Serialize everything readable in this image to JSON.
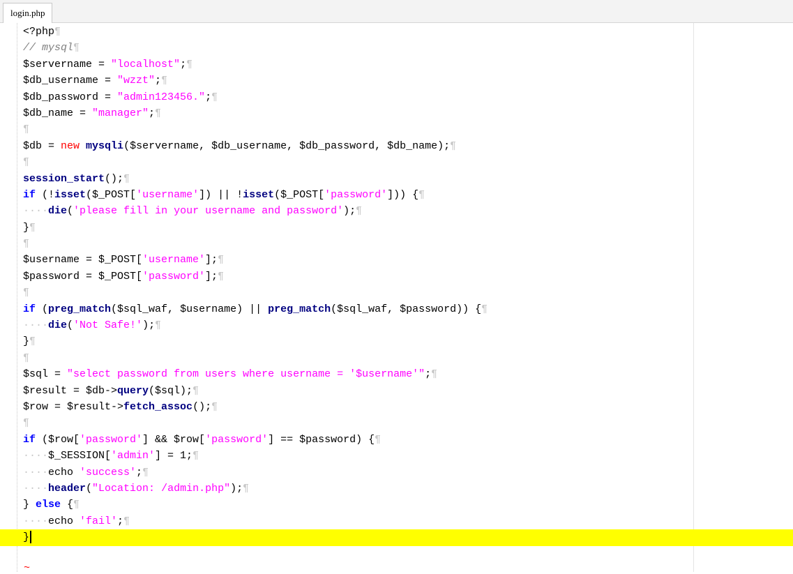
{
  "tab": {
    "label": "login.php"
  },
  "end_marker": "~",
  "lines": [
    [
      {
        "t": "<?php",
        "c": "t"
      }
    ],
    [
      {
        "t": "// mysql",
        "c": "cm"
      }
    ],
    [
      {
        "t": "$servername = ",
        "c": "t"
      },
      {
        "t": "\"localhost\"",
        "c": "str"
      },
      {
        "t": ";",
        "c": "t"
      }
    ],
    [
      {
        "t": "$db_username = ",
        "c": "t"
      },
      {
        "t": "\"wzzt\"",
        "c": "str"
      },
      {
        "t": ";",
        "c": "t"
      }
    ],
    [
      {
        "t": "$db_password = ",
        "c": "t"
      },
      {
        "t": "\"admin123456.\"",
        "c": "str"
      },
      {
        "t": ";",
        "c": "t"
      }
    ],
    [
      {
        "t": "$db_name = ",
        "c": "t"
      },
      {
        "t": "\"manager\"",
        "c": "str"
      },
      {
        "t": ";",
        "c": "t"
      }
    ],
    [],
    [
      {
        "t": "$db = ",
        "c": "t"
      },
      {
        "t": "new",
        "c": "red"
      },
      {
        "t": " ",
        "c": "t"
      },
      {
        "t": "mysqli",
        "c": "fn"
      },
      {
        "t": "($servername, $db_username, $db_password, $db_name);",
        "c": "t"
      }
    ],
    [],
    [
      {
        "t": "session_start",
        "c": "fn"
      },
      {
        "t": "();",
        "c": "t"
      }
    ],
    [
      {
        "t": "if",
        "c": "kw"
      },
      {
        "t": " (!",
        "c": "t"
      },
      {
        "t": "isset",
        "c": "fn"
      },
      {
        "t": "($_POST[",
        "c": "t"
      },
      {
        "t": "'username'",
        "c": "str"
      },
      {
        "t": "]) || !",
        "c": "t"
      },
      {
        "t": "isset",
        "c": "fn"
      },
      {
        "t": "($_POST[",
        "c": "t"
      },
      {
        "t": "'password'",
        "c": "str"
      },
      {
        "t": "])) {",
        "c": "t"
      }
    ],
    [
      {
        "t": "····",
        "c": "ws"
      },
      {
        "t": "die",
        "c": "fn"
      },
      {
        "t": "(",
        "c": "t"
      },
      {
        "t": "'please fill in your username and password'",
        "c": "str"
      },
      {
        "t": ");",
        "c": "t"
      }
    ],
    [
      {
        "t": "}",
        "c": "t"
      }
    ],
    [],
    [
      {
        "t": "$username = $_POST[",
        "c": "t"
      },
      {
        "t": "'username'",
        "c": "str"
      },
      {
        "t": "];",
        "c": "t"
      }
    ],
    [
      {
        "t": "$password = $_POST[",
        "c": "t"
      },
      {
        "t": "'password'",
        "c": "str"
      },
      {
        "t": "];",
        "c": "t"
      }
    ],
    [],
    [
      {
        "t": "if",
        "c": "kw"
      },
      {
        "t": " (",
        "c": "t"
      },
      {
        "t": "preg_match",
        "c": "fn"
      },
      {
        "t": "($sql_waf, $username) || ",
        "c": "t"
      },
      {
        "t": "preg_match",
        "c": "fn"
      },
      {
        "t": "($sql_waf, $password)) {",
        "c": "t"
      }
    ],
    [
      {
        "t": "····",
        "c": "ws"
      },
      {
        "t": "die",
        "c": "fn"
      },
      {
        "t": "(",
        "c": "t"
      },
      {
        "t": "'Not Safe!'",
        "c": "str"
      },
      {
        "t": ");",
        "c": "t"
      }
    ],
    [
      {
        "t": "}",
        "c": "t"
      }
    ],
    [],
    [
      {
        "t": "$sql = ",
        "c": "t"
      },
      {
        "t": "\"select password from users where username = '$username'\"",
        "c": "str"
      },
      {
        "t": ";",
        "c": "t"
      }
    ],
    [
      {
        "t": "$result = $db->",
        "c": "t"
      },
      {
        "t": "query",
        "c": "fn"
      },
      {
        "t": "($sql);",
        "c": "t"
      }
    ],
    [
      {
        "t": "$row = $result->",
        "c": "t"
      },
      {
        "t": "fetch_assoc",
        "c": "fn"
      },
      {
        "t": "();",
        "c": "t"
      }
    ],
    [],
    [
      {
        "t": "if",
        "c": "kw"
      },
      {
        "t": " ($row[",
        "c": "t"
      },
      {
        "t": "'password'",
        "c": "str"
      },
      {
        "t": "] && $row[",
        "c": "t"
      },
      {
        "t": "'password'",
        "c": "str"
      },
      {
        "t": "] == $password) {",
        "c": "t"
      }
    ],
    [
      {
        "t": "····",
        "c": "ws"
      },
      {
        "t": "$_SESSION[",
        "c": "t"
      },
      {
        "t": "'admin'",
        "c": "str"
      },
      {
        "t": "] = 1;",
        "c": "t"
      }
    ],
    [
      {
        "t": "····",
        "c": "ws"
      },
      {
        "t": "echo ",
        "c": "t"
      },
      {
        "t": "'success'",
        "c": "str"
      },
      {
        "t": ";",
        "c": "t"
      }
    ],
    [
      {
        "t": "····",
        "c": "ws"
      },
      {
        "t": "header",
        "c": "fn"
      },
      {
        "t": "(",
        "c": "t"
      },
      {
        "t": "\"Location: /admin.php\"",
        "c": "str"
      },
      {
        "t": ");",
        "c": "t"
      }
    ],
    [
      {
        "t": "} ",
        "c": "t"
      },
      {
        "t": "else",
        "c": "kw"
      },
      {
        "t": " {",
        "c": "t"
      }
    ],
    [
      {
        "t": "····",
        "c": "ws"
      },
      {
        "t": "echo ",
        "c": "t"
      },
      {
        "t": "'fail'",
        "c": "str"
      },
      {
        "t": ";",
        "c": "t"
      }
    ],
    [
      {
        "t": "}",
        "c": "t"
      }
    ]
  ],
  "current_line": 31,
  "eol_marker": "¶",
  "colors": {
    "current_line": "#ffff00",
    "string": "#ff00ff",
    "keyword": "#0000ff",
    "function": "#000080",
    "comment": "#808080",
    "new_keyword": "#ff0000"
  }
}
